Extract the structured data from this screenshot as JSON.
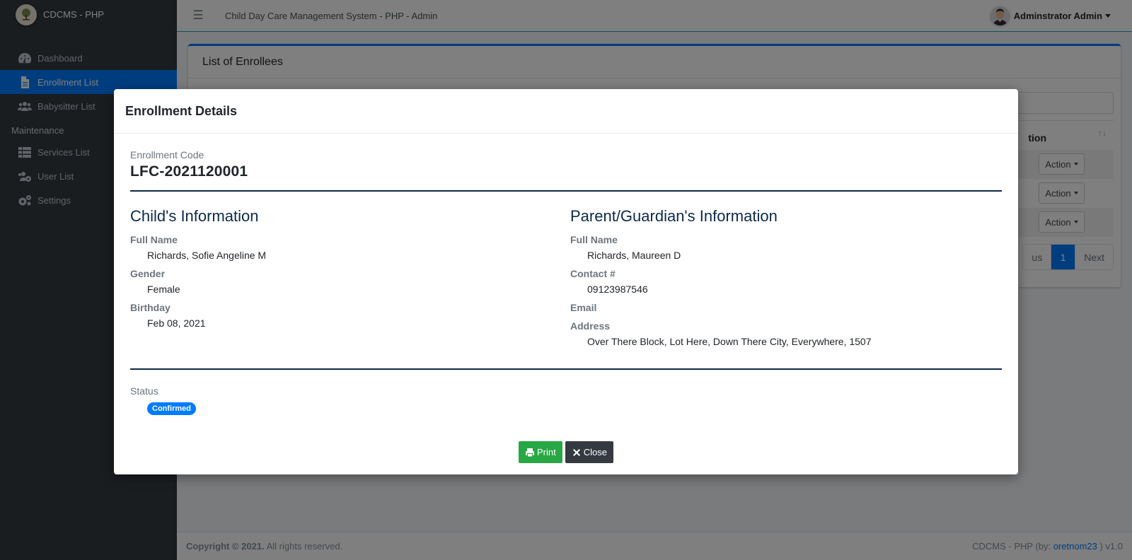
{
  "brand": {
    "name": "CDCMS - PHP",
    "logo_icon": "tree-logo-icon"
  },
  "sidebar": {
    "items": [
      {
        "label": "Dashboard",
        "icon": "tachometer-icon",
        "active": false
      },
      {
        "label": "Enrollment List",
        "icon": "file-icon",
        "active": true
      },
      {
        "label": "Babysitter List",
        "icon": "users-icon",
        "active": false
      }
    ],
    "section_header": "Maintenance",
    "maintenance_items": [
      {
        "label": "Services List",
        "icon": "th-list-icon"
      },
      {
        "label": "User List",
        "icon": "users-cog-icon"
      },
      {
        "label": "Settings",
        "icon": "cogs-icon"
      }
    ]
  },
  "topbar": {
    "menu_icon": "hamburger-icon",
    "title": "Child Day Care Management System - PHP - Admin",
    "user_name": "Adminstrator Admin"
  },
  "page": {
    "card_title": "List of Enrollees",
    "table_header_partial": "tion",
    "sort_icon": "sort-icon",
    "action_buttons": [
      "Action",
      "Action",
      "Action"
    ],
    "pagination": {
      "previous_partial": "us",
      "current": "1",
      "next": "Next"
    }
  },
  "footer": {
    "copyright_bold": "Copyright © 2021.",
    "copyright_rest": " All rights reserved.",
    "credit_prefix": "CDCMS - PHP (by: ",
    "credit_link": "oretnom23",
    "credit_suffix": " ) v1.0"
  },
  "modal": {
    "title": "Enrollment Details",
    "code_label": "Enrollment Code",
    "code_value": "LFC-2021120001",
    "child": {
      "section_title": "Child's Information",
      "fields": [
        {
          "label": "Full Name",
          "value": "Richards, Sofie Angeline M"
        },
        {
          "label": "Gender",
          "value": "Female"
        },
        {
          "label": "Birthday",
          "value": "Feb 08, 2021"
        }
      ]
    },
    "parent": {
      "section_title": "Parent/Guardian's Information",
      "fields": [
        {
          "label": "Full Name",
          "value": "Richards, Maureen D"
        },
        {
          "label": "Contact #",
          "value": "09123987546"
        },
        {
          "label": "Email",
          "value": ""
        },
        {
          "label": "Address",
          "value": "Over There Block, Lot Here, Down There City, Everywhere, 1507"
        }
      ]
    },
    "status_label": "Status",
    "status_value": "Confirmed",
    "buttons": {
      "print": "Print",
      "close": "Close"
    }
  },
  "colors": {
    "primary": "#007bff",
    "sidebar_bg": "#343a40",
    "success": "#28a745",
    "dark": "#343a40",
    "section_title": "#0c2a4a"
  }
}
